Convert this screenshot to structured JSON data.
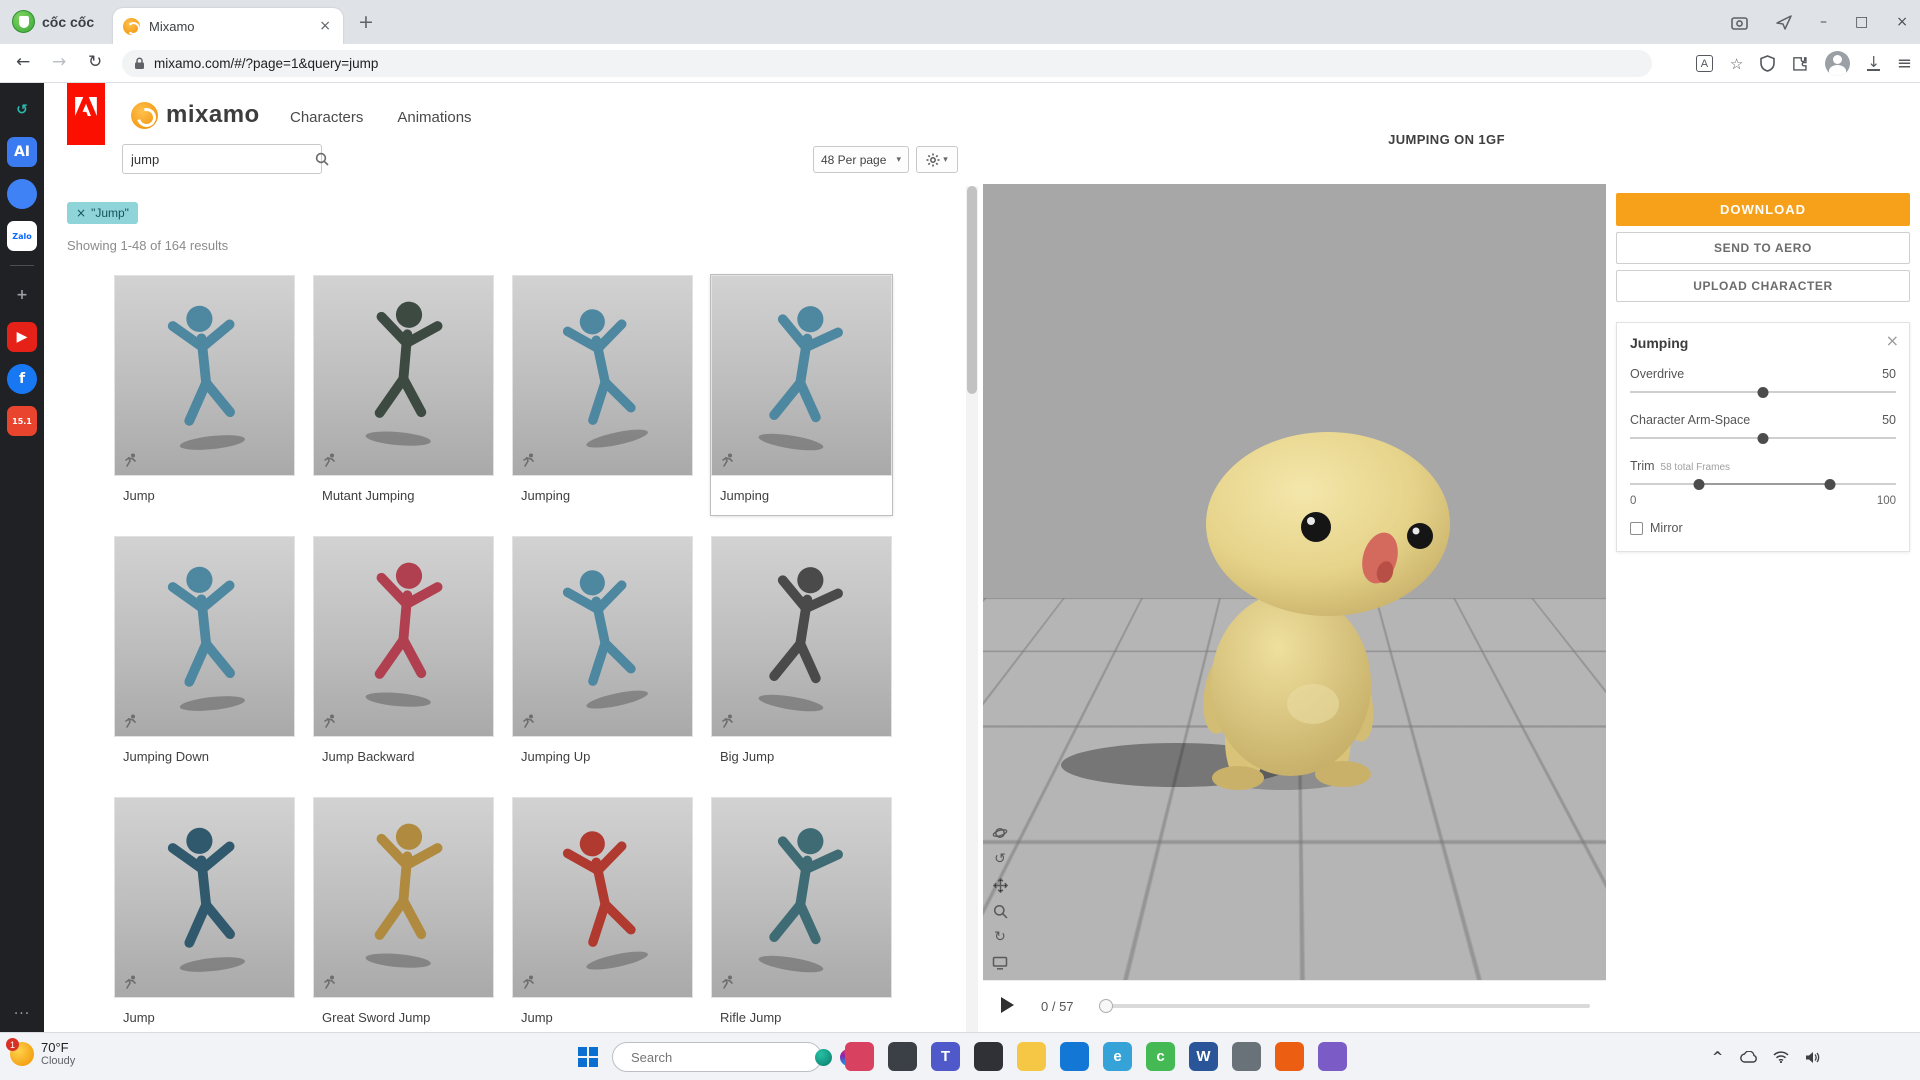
{
  "browser": {
    "brand": "cốc cốc",
    "tab_title": "Mixamo",
    "url": "mixamo.com/#/?page=1&query=jump",
    "window": {
      "minimize": "–",
      "maximize": "□",
      "close": "×"
    }
  },
  "icons": {
    "back": "←",
    "forward": "→",
    "reload": "↻",
    "close": "×",
    "new_tab": "+",
    "menu": "≡",
    "star": "☆",
    "translate": "A",
    "download": "↓",
    "chevron_up": "^",
    "more": "···",
    "caret": "▾",
    "undo": "↺",
    "redo": "↻"
  },
  "cc_sidebar": {
    "items": [
      {
        "name": "history",
        "glyph": "↺",
        "color": "#2bb8ac",
        "bg": "",
        "shape": "none"
      },
      {
        "name": "ai-assistant",
        "glyph": "AI",
        "color": "#ffffff",
        "bg": "#3a7bf2",
        "shape": "square"
      },
      {
        "name": "messenger",
        "glyph": "",
        "color": "#ffffff",
        "bg": "#3f82f5",
        "shape": "circle"
      },
      {
        "name": "zalo",
        "glyph": "Zalo",
        "color": "#0a68fe",
        "bg": "#ffffff",
        "shape": "square",
        "small": true
      },
      {
        "name": "add",
        "glyph": "+",
        "color": "#9aa0a6",
        "bg": "",
        "shape": "none"
      },
      {
        "name": "youtube",
        "glyph": "▶",
        "color": "#ffffff",
        "bg": "#e62117",
        "shape": "square"
      },
      {
        "name": "facebook",
        "glyph": "f",
        "color": "#ffffff",
        "bg": "#1877f2",
        "shape": "circle"
      },
      {
        "name": "sale-15-1",
        "glyph": "15.1",
        "color": "#ffffff",
        "bg": "#e8442e",
        "shape": "square",
        "small": true
      }
    ]
  },
  "mixamo": {
    "logo_text": "mixamo",
    "nav": [
      {
        "label": "Characters"
      },
      {
        "label": "Animations"
      }
    ],
    "search_value": "jump",
    "per_page": "48 Per page",
    "chip": {
      "close": "×",
      "label": "\"Jump\""
    },
    "results_info": "Showing 1-48 of 164 results",
    "results": [
      {
        "label": "Jump",
        "color": "#4e87a0"
      },
      {
        "label": "Mutant Jumping",
        "color": "#3d4a42"
      },
      {
        "label": "Jumping",
        "color": "#4e87a0"
      },
      {
        "label": "Jumping",
        "color": "#4e87a0",
        "selected": true
      },
      {
        "label": "Jumping Down",
        "color": "#4e87a0"
      },
      {
        "label": "Jump Backward",
        "color": "#b04050"
      },
      {
        "label": "Jumping Up",
        "color": "#4e87a0"
      },
      {
        "label": "Big Jump",
        "color": "#4a4a4a"
      },
      {
        "label": "Jump",
        "color": "#31596e"
      },
      {
        "label": "Great Sword Jump",
        "color": "#b08a3e"
      },
      {
        "label": "Jump",
        "color": "#b03a30"
      },
      {
        "label": "Rifle Jump",
        "color": "#3f6b75"
      }
    ]
  },
  "viewer": {
    "title": "JUMPING ON 1GF",
    "buttons": {
      "download": "DOWNLOAD",
      "aero": "SEND TO AERO",
      "upload": "UPLOAD CHARACTER"
    },
    "panel": {
      "title": "Jumping",
      "close": "×",
      "overdrive": {
        "label": "Overdrive",
        "value": "50",
        "percent": 50
      },
      "armspace": {
        "label": "Character Arm-Space",
        "value": "50",
        "percent": 50
      },
      "trim": {
        "label": "Trim",
        "note": "58 total Frames",
        "min": "0",
        "max": "100",
        "start_percent": 26,
        "end_percent": 75
      },
      "mirror_label": "Mirror"
    },
    "player": {
      "frame": "0 / 57",
      "progress_percent": 1
    }
  },
  "taskbar": {
    "weather": {
      "badge": "1",
      "temp": "70°F",
      "desc": "Cloudy"
    },
    "search_placeholder": "Search",
    "apps": [
      {
        "name": "photos",
        "color": "#d8415f",
        "glyph": ""
      },
      {
        "name": "monitor",
        "color": "#3b3f46",
        "glyph": ""
      },
      {
        "name": "teams",
        "color": "#5059c9",
        "glyph": "T"
      },
      {
        "name": "task-view",
        "color": "#2f3136",
        "glyph": ""
      },
      {
        "name": "file-explorer",
        "color": "#f5c744",
        "glyph": ""
      },
      {
        "name": "store",
        "color": "#1377d6",
        "glyph": ""
      },
      {
        "name": "edge",
        "color": "#35a3d8",
        "glyph": "e"
      },
      {
        "name": "coccoc",
        "color": "#45b954",
        "glyph": "c"
      },
      {
        "name": "word",
        "color": "#2a5699",
        "glyph": "W"
      },
      {
        "name": "settings",
        "color": "#697179",
        "glyph": ""
      },
      {
        "name": "media-orange",
        "color": "#ec5f12",
        "glyph": ""
      },
      {
        "name": "media-purple",
        "color": "#7b5cc6",
        "glyph": ""
      }
    ]
  }
}
